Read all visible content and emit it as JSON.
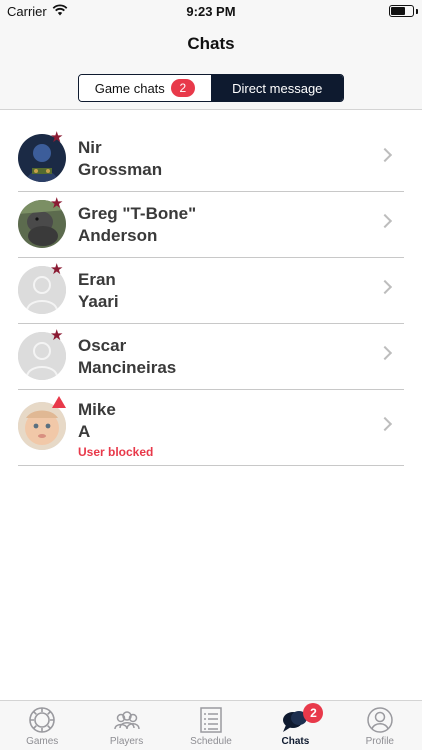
{
  "status_bar": {
    "carrier": "Carrier",
    "time": "9:23 PM"
  },
  "header": {
    "title": "Chats"
  },
  "segments": [
    {
      "label": "Game chats",
      "badge": "2",
      "selected": false
    },
    {
      "label": "Direct message",
      "selected": true
    }
  ],
  "chats": [
    {
      "first": "Nir",
      "last": "Grossman",
      "marker": "star-icon",
      "avatar": "photo"
    },
    {
      "first": "Greg \"T-Bone\"",
      "last": "Anderson",
      "marker": "star-icon",
      "avatar": "photo"
    },
    {
      "first": "Eran",
      "last": "Yaari",
      "marker": "star-icon",
      "avatar": "placeholder"
    },
    {
      "first": "Oscar",
      "last": "Mancineiras",
      "marker": "star-icon",
      "avatar": "placeholder"
    },
    {
      "first": "Mike",
      "last": "A",
      "marker": "warning-icon",
      "avatar": "photo",
      "status": "User blocked"
    }
  ],
  "tabs": [
    {
      "label": "Games",
      "icon": "poker-chip-icon"
    },
    {
      "label": "Players",
      "icon": "players-icon"
    },
    {
      "label": "Schedule",
      "icon": "schedule-icon"
    },
    {
      "label": "Chats",
      "icon": "chat-bubbles-icon",
      "badge": "2",
      "active": true
    },
    {
      "label": "Profile",
      "icon": "profile-icon"
    }
  ],
  "colors": {
    "accent": "#0e1a2f",
    "badge": "#e8394a",
    "star": "#8b1b33"
  }
}
